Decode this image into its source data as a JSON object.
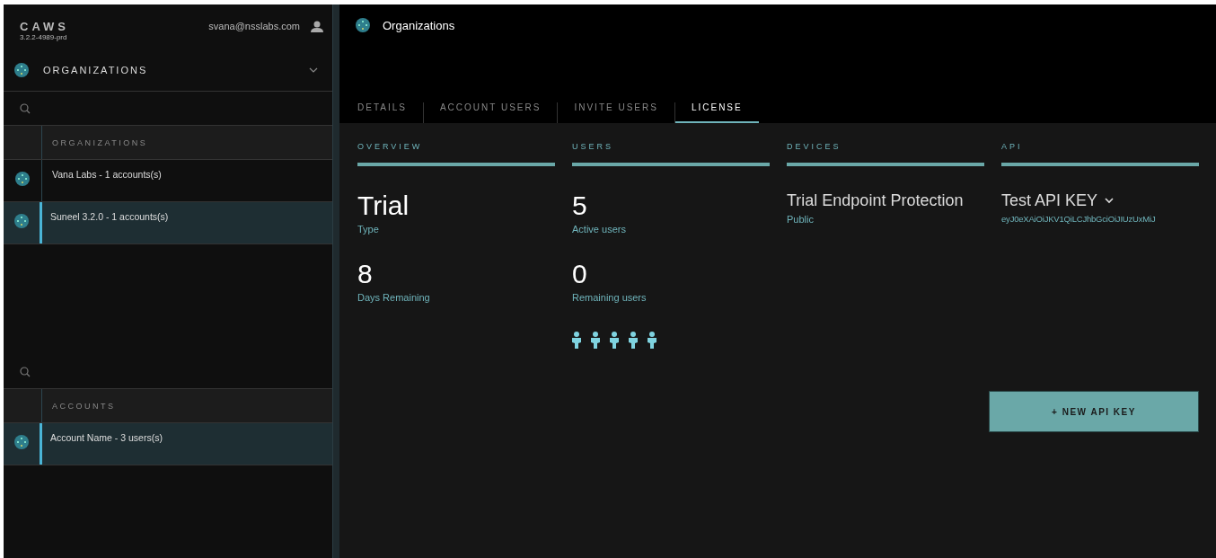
{
  "sidebar": {
    "logo": "CAWS",
    "version": "3.2.2-4989-prd",
    "user_email": "svana@nsslabs.com",
    "dropdown": {
      "label": "ORGANIZATIONS",
      "expanded": false
    },
    "lists": [
      {
        "heading": "ORGANIZATIONS",
        "items": [
          {
            "label": "Vana Labs - 1 accounts(s)",
            "selected": false
          },
          {
            "label": "Suneel 3.2.0 - 1 accounts(s)",
            "selected": true
          }
        ]
      },
      {
        "heading": "ACCOUNTS",
        "items": [
          {
            "label": "Account Name - 3 users(s)",
            "selected": true
          }
        ]
      }
    ]
  },
  "main": {
    "title": "Organizations",
    "tabs": [
      {
        "label": "DETAILS",
        "selected": false
      },
      {
        "label": "ACCOUNT USERS",
        "selected": false
      },
      {
        "label": "INVITE USERS",
        "selected": false
      },
      {
        "label": "LICENSE",
        "selected": true
      }
    ],
    "sections": [
      {
        "kind": "stats",
        "heading": "OVERVIEW",
        "stats": [
          {
            "value": "Trial",
            "label": "Type"
          },
          {
            "value": "8",
            "label": "Days Remaining"
          }
        ]
      },
      {
        "kind": "stats",
        "heading": "USERS",
        "stats": [
          {
            "value": "5",
            "label": "Active users"
          },
          {
            "value": "0",
            "label": "Remaining users"
          }
        ],
        "user_figures": true
      },
      {
        "kind": "product",
        "heading": "DEVICES",
        "title": "Trial Endpoint Protection",
        "subtitle": "Public"
      },
      {
        "kind": "api",
        "heading": "API",
        "title": "Test API KEY",
        "subtitle": "eyJ0eXAiOiJKV1QiLCJhbGciOiJIUzUxMiJ",
        "button": "+ NEW API KEY"
      }
    ]
  }
}
